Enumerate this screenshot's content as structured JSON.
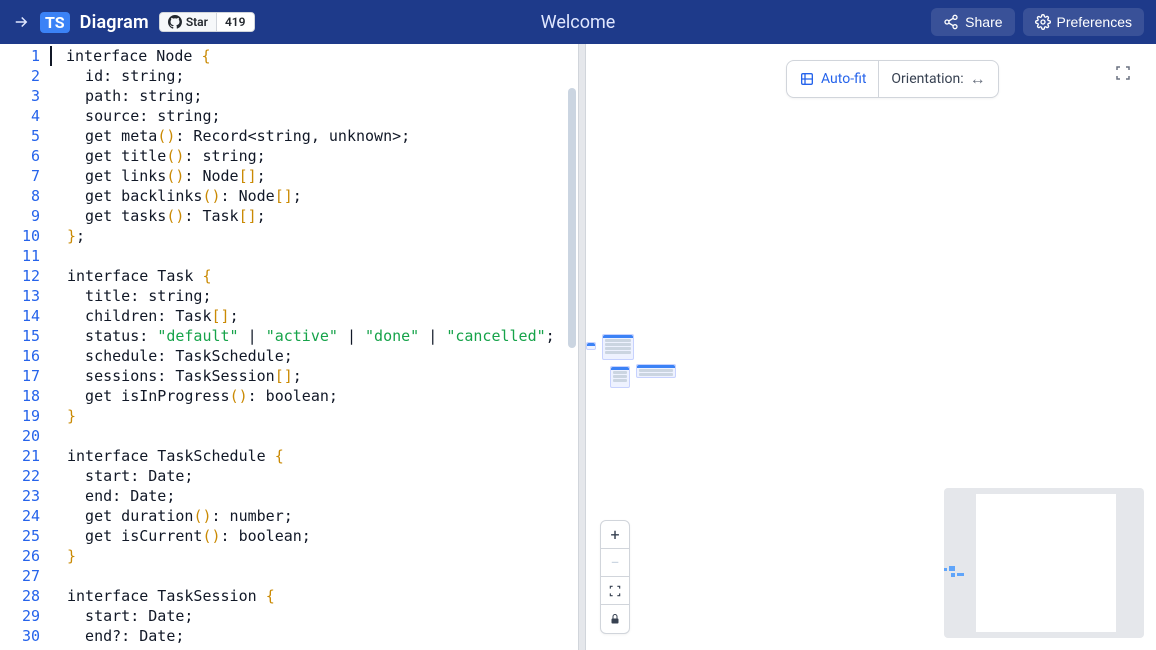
{
  "header": {
    "logo_text": "TS",
    "brand": "Diagram",
    "github_star_label": "Star",
    "github_star_count": "419",
    "title": "Welcome",
    "share_label": "Share",
    "preferences_label": "Preferences"
  },
  "editor": {
    "lines": [
      {
        "n": 1,
        "segs": [
          {
            "t": "interface Node "
          },
          {
            "t": "{",
            "c": "y"
          }
        ]
      },
      {
        "n": 2,
        "segs": [
          {
            "t": "  id: string;"
          }
        ]
      },
      {
        "n": 3,
        "segs": [
          {
            "t": "  path: string;"
          }
        ]
      },
      {
        "n": 4,
        "segs": [
          {
            "t": "  source: string;"
          }
        ]
      },
      {
        "n": 5,
        "segs": [
          {
            "t": "  get meta"
          },
          {
            "t": "()",
            "c": "y"
          },
          {
            "t": ": Record<string, unknown>;"
          }
        ]
      },
      {
        "n": 6,
        "segs": [
          {
            "t": "  get title"
          },
          {
            "t": "()",
            "c": "y"
          },
          {
            "t": ": string;"
          }
        ]
      },
      {
        "n": 7,
        "segs": [
          {
            "t": "  get links"
          },
          {
            "t": "()",
            "c": "y"
          },
          {
            "t": ": Node"
          },
          {
            "t": "[]",
            "c": "y"
          },
          {
            "t": ";"
          }
        ]
      },
      {
        "n": 8,
        "segs": [
          {
            "t": "  get backlinks"
          },
          {
            "t": "()",
            "c": "y"
          },
          {
            "t": ": Node"
          },
          {
            "t": "[]",
            "c": "y"
          },
          {
            "t": ";"
          }
        ]
      },
      {
        "n": 9,
        "segs": [
          {
            "t": "  get tasks"
          },
          {
            "t": "()",
            "c": "y"
          },
          {
            "t": ": Task"
          },
          {
            "t": "[]",
            "c": "y"
          },
          {
            "t": ";"
          }
        ]
      },
      {
        "n": 10,
        "segs": [
          {
            "t": "}",
            "c": "y"
          },
          {
            "t": ";"
          }
        ]
      },
      {
        "n": 11,
        "segs": [
          {
            "t": ""
          }
        ]
      },
      {
        "n": 12,
        "segs": [
          {
            "t": "interface Task "
          },
          {
            "t": "{",
            "c": "y"
          }
        ]
      },
      {
        "n": 13,
        "segs": [
          {
            "t": "  title: string;"
          }
        ]
      },
      {
        "n": 14,
        "segs": [
          {
            "t": "  children: Task"
          },
          {
            "t": "[]",
            "c": "y"
          },
          {
            "t": ";"
          }
        ]
      },
      {
        "n": 15,
        "segs": [
          {
            "t": "  status: "
          },
          {
            "t": "\"default\"",
            "c": "g"
          },
          {
            "t": " | "
          },
          {
            "t": "\"active\"",
            "c": "g"
          },
          {
            "t": " | "
          },
          {
            "t": "\"done\"",
            "c": "g"
          },
          {
            "t": " | "
          },
          {
            "t": "\"cancelled\"",
            "c": "g"
          },
          {
            "t": ";"
          }
        ]
      },
      {
        "n": 16,
        "segs": [
          {
            "t": "  schedule: TaskSchedule;"
          }
        ]
      },
      {
        "n": 17,
        "segs": [
          {
            "t": "  sessions: TaskSession"
          },
          {
            "t": "[]",
            "c": "y"
          },
          {
            "t": ";"
          }
        ]
      },
      {
        "n": 18,
        "segs": [
          {
            "t": "  get isInProgress"
          },
          {
            "t": "()",
            "c": "y"
          },
          {
            "t": ": boolean;"
          }
        ]
      },
      {
        "n": 19,
        "segs": [
          {
            "t": "}",
            "c": "y"
          }
        ]
      },
      {
        "n": 20,
        "segs": [
          {
            "t": ""
          }
        ]
      },
      {
        "n": 21,
        "segs": [
          {
            "t": "interface TaskSchedule "
          },
          {
            "t": "{",
            "c": "y"
          }
        ]
      },
      {
        "n": 22,
        "segs": [
          {
            "t": "  start: Date;"
          }
        ]
      },
      {
        "n": 23,
        "segs": [
          {
            "t": "  end: Date;"
          }
        ]
      },
      {
        "n": 24,
        "segs": [
          {
            "t": "  get duration"
          },
          {
            "t": "()",
            "c": "y"
          },
          {
            "t": ": number;"
          }
        ]
      },
      {
        "n": 25,
        "segs": [
          {
            "t": "  get isCurrent"
          },
          {
            "t": "()",
            "c": "y"
          },
          {
            "t": ": boolean;"
          }
        ]
      },
      {
        "n": 26,
        "segs": [
          {
            "t": "}",
            "c": "y"
          }
        ]
      },
      {
        "n": 27,
        "segs": [
          {
            "t": ""
          }
        ]
      },
      {
        "n": 28,
        "segs": [
          {
            "t": "interface TaskSession "
          },
          {
            "t": "{",
            "c": "y"
          }
        ]
      },
      {
        "n": 29,
        "segs": [
          {
            "t": "  start: Date;"
          }
        ]
      },
      {
        "n": 30,
        "segs": [
          {
            "t": "  end?: Date;"
          }
        ]
      }
    ]
  },
  "toolbar": {
    "autofit_label": "Auto-fit",
    "orientation_label": "Orientation:",
    "orientation_icon": "↔"
  },
  "zoom": {
    "plus": "+",
    "minus": "−"
  }
}
